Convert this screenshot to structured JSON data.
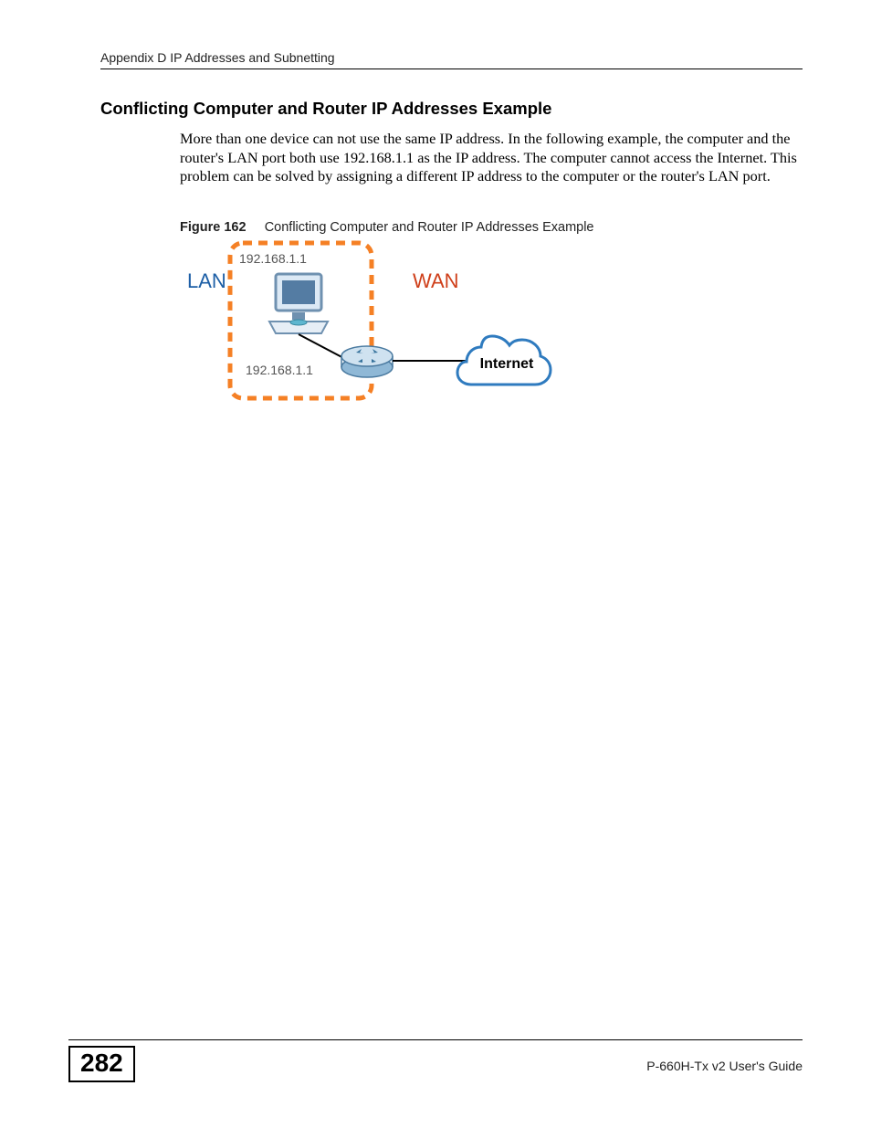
{
  "header": {
    "running_head": "Appendix D IP Addresses and Subnetting"
  },
  "section": {
    "heading": "Conflicting Computer and Router IP Addresses Example",
    "paragraph": "More than one device can not use the same IP address. In the following example, the computer and the router's LAN port both use 192.168.1.1 as the IP address. The computer cannot access the Internet. This problem can be solved by assigning a different IP address to the computer or the router's LAN port."
  },
  "figure": {
    "label": "Figure 162",
    "caption": "Conflicting Computer and Router IP Addresses Example",
    "lan_label": "LAN",
    "wan_label": "WAN",
    "computer_ip": "192.168.1.1",
    "router_ip": "192.168.1.1",
    "internet_label": "Internet"
  },
  "footer": {
    "page_number": "282",
    "guide_title": "P-660H-Tx v2 User's Guide"
  }
}
